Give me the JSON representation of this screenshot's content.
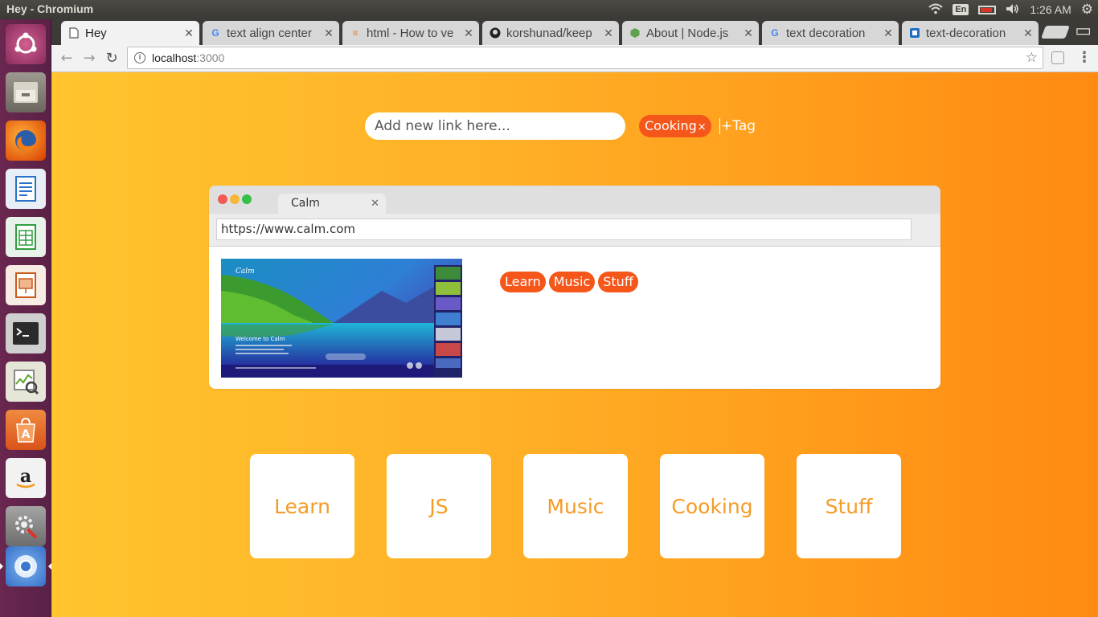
{
  "system": {
    "window_title": "Hey - Chromium",
    "keyboard_layout": "En",
    "clock": "1:26 AM"
  },
  "launcher": {
    "items": [
      {
        "name": "ubuntu-dash",
        "color": "#c64a86"
      },
      {
        "name": "files",
        "color": "#8a8680"
      },
      {
        "name": "firefox",
        "color": "#e66000"
      },
      {
        "name": "writer",
        "color": "#2a72c8"
      },
      {
        "name": "calc",
        "color": "#2f9e3f"
      },
      {
        "name": "impress",
        "color": "#c85a1e"
      },
      {
        "name": "terminal",
        "color": "#2b2b2b"
      },
      {
        "name": "system-monitor",
        "color": "#5aa52a"
      },
      {
        "name": "software-center",
        "color": "#e8692a"
      },
      {
        "name": "amazon",
        "color": "#f0f0f0"
      },
      {
        "name": "system-settings",
        "color": "#8a8a8a"
      },
      {
        "name": "chromium",
        "color": "#4a8fe0"
      }
    ]
  },
  "tabs": [
    {
      "label": "Hey",
      "active": true,
      "icon": "page-icon"
    },
    {
      "label": "text align center",
      "icon": "google-icon"
    },
    {
      "label": "html - How to ve",
      "icon": "stackoverflow-icon"
    },
    {
      "label": "korshunad/keep",
      "icon": "github-icon"
    },
    {
      "label": "About | Node.js",
      "icon": "nodejs-icon"
    },
    {
      "label": "text decoration",
      "icon": "google-icon"
    },
    {
      "label": "text-decoration",
      "icon": "mdn-icon"
    }
  ],
  "address_bar": {
    "host": "localhost",
    "port": ":3000"
  },
  "app": {
    "link_input_placeholder": "Add new link here...",
    "selected_tag": "Cooking",
    "remove_symbol": "×",
    "add_tag_label": "+Tag",
    "card": {
      "tab_title": "Calm",
      "url": "https://www.calm.com",
      "thumbnail_heading": "Welcome to Calm",
      "thumbnail_logo": "Calm",
      "tags": [
        "Learn",
        "Music",
        "Stuff"
      ]
    },
    "categories": [
      "Learn",
      "JS",
      "Music",
      "Cooking",
      "Stuff"
    ]
  },
  "colors": {
    "tag_chip": "#f5561a",
    "tile_text": "#f59c26",
    "page_gradient_start": "#ffc42e",
    "page_gradient_end": "#ff8a12"
  }
}
